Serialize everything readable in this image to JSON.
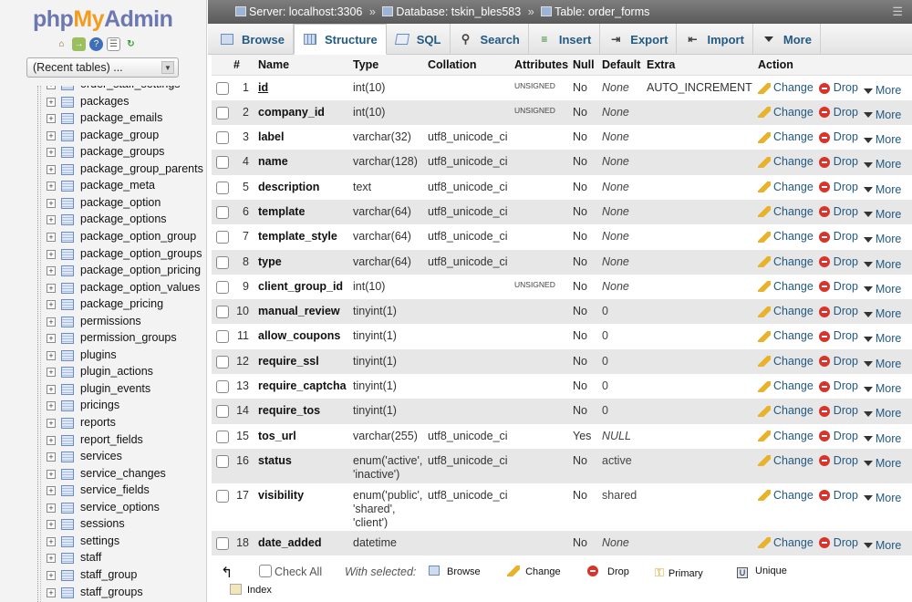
{
  "logo": {
    "php": "php",
    "my": "My",
    "admin": "Admin"
  },
  "sidebar": {
    "recent_tables": "(Recent tables) ...",
    "quick_icons": [
      "home-icon",
      "exit-icon",
      "help-icon",
      "docs-icon",
      "reload-icon"
    ],
    "tables": [
      "order_staff_settings",
      "packages",
      "package_emails",
      "package_group",
      "package_groups",
      "package_group_parents",
      "package_meta",
      "package_option",
      "package_options",
      "package_option_group",
      "package_option_groups",
      "package_option_pricing",
      "package_option_values",
      "package_pricing",
      "permissions",
      "permission_groups",
      "plugins",
      "plugin_actions",
      "plugin_events",
      "pricings",
      "reports",
      "report_fields",
      "services",
      "service_changes",
      "service_fields",
      "service_options",
      "sessions",
      "settings",
      "staff",
      "staff_group",
      "staff_groups"
    ]
  },
  "breadcrumb": {
    "server": "Server: localhost:3306",
    "database": "Database: tskin_bles583",
    "table": "Table: order_forms",
    "separator": "»"
  },
  "tabs": [
    {
      "label": "Browse",
      "icon": "browse-icon"
    },
    {
      "label": "Structure",
      "icon": "structure-icon"
    },
    {
      "label": "SQL",
      "icon": "sql-icon"
    },
    {
      "label": "Search",
      "icon": "search-icon"
    },
    {
      "label": "Insert",
      "icon": "insert-icon"
    },
    {
      "label": "Export",
      "icon": "export-icon"
    },
    {
      "label": "Import",
      "icon": "import-icon"
    },
    {
      "label": "More",
      "icon": "more-icon"
    }
  ],
  "columns": {
    "num": "#",
    "name": "Name",
    "type": "Type",
    "collation": "Collation",
    "attributes": "Attributes",
    "null": "Null",
    "default": "Default",
    "extra": "Extra",
    "action": "Action"
  },
  "actions": {
    "change": "Change",
    "drop": "Drop",
    "more": "More"
  },
  "rows": [
    {
      "n": "1",
      "name": "id",
      "type": "int(10)",
      "collation": "",
      "attr": "UNSIGNED",
      "null": "No",
      "default": "None",
      "extra": "AUTO_INCREMENT"
    },
    {
      "n": "2",
      "name": "company_id",
      "type": "int(10)",
      "collation": "",
      "attr": "UNSIGNED",
      "null": "No",
      "default": "None",
      "extra": ""
    },
    {
      "n": "3",
      "name": "label",
      "type": "varchar(32)",
      "collation": "utf8_unicode_ci",
      "attr": "",
      "null": "No",
      "default": "None",
      "extra": ""
    },
    {
      "n": "4",
      "name": "name",
      "type": "varchar(128)",
      "collation": "utf8_unicode_ci",
      "attr": "",
      "null": "No",
      "default": "None",
      "extra": ""
    },
    {
      "n": "5",
      "name": "description",
      "type": "text",
      "collation": "utf8_unicode_ci",
      "attr": "",
      "null": "No",
      "default": "None",
      "extra": ""
    },
    {
      "n": "6",
      "name": "template",
      "type": "varchar(64)",
      "collation": "utf8_unicode_ci",
      "attr": "",
      "null": "No",
      "default": "None",
      "extra": ""
    },
    {
      "n": "7",
      "name": "template_style",
      "type": "varchar(64)",
      "collation": "utf8_unicode_ci",
      "attr": "",
      "null": "No",
      "default": "None",
      "extra": ""
    },
    {
      "n": "8",
      "name": "type",
      "type": "varchar(64)",
      "collation": "utf8_unicode_ci",
      "attr": "",
      "null": "No",
      "default": "None",
      "extra": ""
    },
    {
      "n": "9",
      "name": "client_group_id",
      "type": "int(10)",
      "collation": "",
      "attr": "UNSIGNED",
      "null": "No",
      "default": "None",
      "extra": ""
    },
    {
      "n": "10",
      "name": "manual_review",
      "type": "tinyint(1)",
      "collation": "",
      "attr": "",
      "null": "No",
      "default": "0",
      "extra": ""
    },
    {
      "n": "11",
      "name": "allow_coupons",
      "type": "tinyint(1)",
      "collation": "",
      "attr": "",
      "null": "No",
      "default": "0",
      "extra": ""
    },
    {
      "n": "12",
      "name": "require_ssl",
      "type": "tinyint(1)",
      "collation": "",
      "attr": "",
      "null": "No",
      "default": "0",
      "extra": ""
    },
    {
      "n": "13",
      "name": "require_captcha",
      "type": "tinyint(1)",
      "collation": "",
      "attr": "",
      "null": "No",
      "default": "0",
      "extra": ""
    },
    {
      "n": "14",
      "name": "require_tos",
      "type": "tinyint(1)",
      "collation": "",
      "attr": "",
      "null": "No",
      "default": "0",
      "extra": ""
    },
    {
      "n": "15",
      "name": "tos_url",
      "type": "varchar(255)",
      "collation": "utf8_unicode_ci",
      "attr": "",
      "null": "Yes",
      "default": "NULL",
      "extra": ""
    },
    {
      "n": "16",
      "name": "status",
      "type": "enum('active', 'inactive')",
      "collation": "utf8_unicode_ci",
      "attr": "",
      "null": "No",
      "default": "active",
      "extra": ""
    },
    {
      "n": "17",
      "name": "visibility",
      "type": "enum('public', 'shared', 'client')",
      "collation": "utf8_unicode_ci",
      "attr": "",
      "null": "No",
      "default": "shared",
      "extra": ""
    },
    {
      "n": "18",
      "name": "date_added",
      "type": "datetime",
      "collation": "",
      "attr": "",
      "null": "No",
      "default": "None",
      "extra": ""
    }
  ],
  "footer": {
    "check_all": "Check All",
    "with_selected": "With selected:",
    "browse": "Browse",
    "change": "Change",
    "drop": "Drop",
    "primary": "Primary",
    "unique": "Unique",
    "index": "Index"
  },
  "colors": {
    "link": "#235a81",
    "drop": "#d9342b",
    "logo_blue": "#6c78af",
    "logo_orange": "#f29c1f"
  }
}
